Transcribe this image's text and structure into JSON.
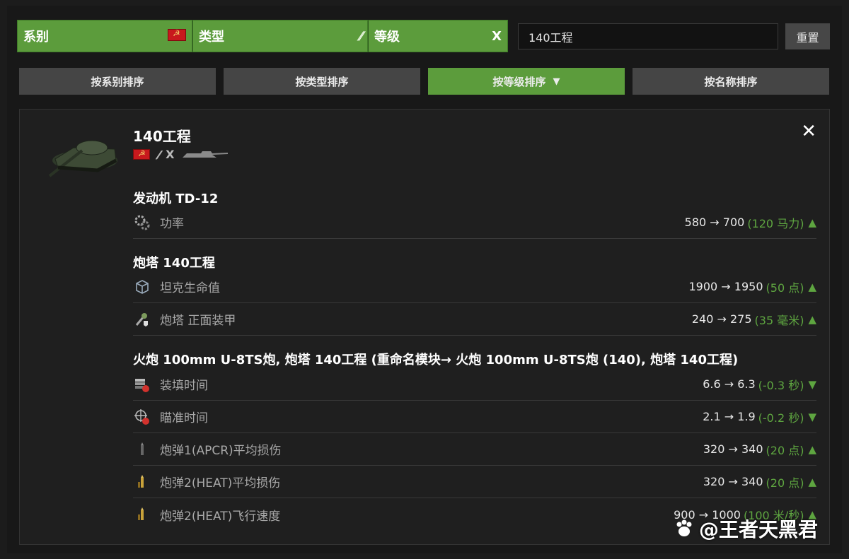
{
  "filters": {
    "nation_label": "系别",
    "type_label": "类型",
    "tier_label": "等级",
    "tier_value": "X",
    "search_value": "140工程",
    "reset_label": "重置"
  },
  "sort": {
    "by_nation": "按系别排序",
    "by_type": "按类型排序",
    "by_tier": "按等级排序",
    "by_name": "按名称排序",
    "active_arrow": "▼"
  },
  "card": {
    "tank_name": "140工程",
    "tier": "X",
    "close": "✕",
    "sections": [
      {
        "title": "发动机 TD-12",
        "rows": [
          {
            "label": "功率",
            "value": "580 → 700",
            "diff": "(120 马力)",
            "dir": "▲",
            "icon": "engine-gears-icon"
          }
        ]
      },
      {
        "title": "炮塔 140工程",
        "rows": [
          {
            "label": "坦克生命值",
            "value": "1900 → 1950",
            "diff": "(50 点)",
            "dir": "▲",
            "icon": "hitpoints-cube-icon"
          },
          {
            "label": "炮塔 正面装甲",
            "value": "240 → 275",
            "diff": "(35 毫米)",
            "dir": "▲",
            "icon": "turret-armor-icon"
          }
        ]
      },
      {
        "title": "火炮 100mm U-8TS炮, 炮塔 140工程 (重命名模块→ 火炮 100mm U-8TS炮 (140), 炮塔 140工程)",
        "rows": [
          {
            "label": "装填时间",
            "value": "6.6 → 6.3",
            "diff": "(-0.3 秒)",
            "dir": "▼",
            "icon": "reload-shells-icon"
          },
          {
            "label": "瞄准时间",
            "value": "2.1 → 1.9",
            "diff": "(-0.2 秒)",
            "dir": "▼",
            "icon": "aim-crosshair-icon"
          },
          {
            "label": "炮弹1(APCR)平均损伤",
            "value": "320 → 340",
            "diff": "(20 点)",
            "dir": "▲",
            "icon": "shell-apcr-icon"
          },
          {
            "label": "炮弹2(HEAT)平均损伤",
            "value": "320 → 340",
            "diff": "(20 点)",
            "dir": "▲",
            "icon": "shell-heat-icon"
          },
          {
            "label": "炮弹2(HEAT)飞行速度",
            "value": "900 → 1000",
            "diff": "(100 米/秒)",
            "dir": "▲",
            "icon": "shell-heat-velocity-icon"
          }
        ]
      }
    ]
  },
  "watermark": "@王者天黑君"
}
